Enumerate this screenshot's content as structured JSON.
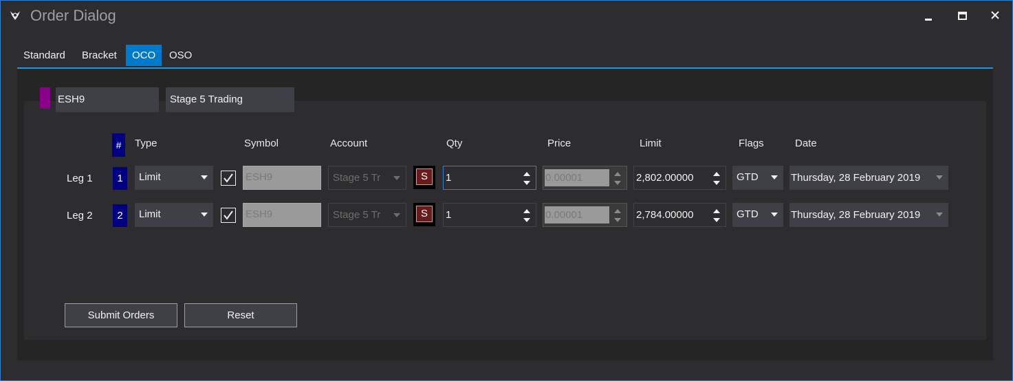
{
  "window": {
    "title": "Order Dialog"
  },
  "tabs": [
    {
      "label": "Standard"
    },
    {
      "label": "Bracket"
    },
    {
      "label": "OCO",
      "active": true
    },
    {
      "label": "OSO"
    }
  ],
  "header": {
    "instrument": "ESH9",
    "account": "Stage 5 Trading",
    "swatch_color": "#8b008b"
  },
  "columns": {
    "hash": "#",
    "type": "Type",
    "symbol": "Symbol",
    "account": "Account",
    "qty": "Qty",
    "price": "Price",
    "limit": "Limit",
    "flags": "Flags",
    "date": "Date"
  },
  "legs": [
    {
      "label": "Leg 1",
      "num": "1",
      "type": "Limit",
      "checked": true,
      "symbol": "ESH9",
      "account": "Stage 5 Tr",
      "s_button": "S",
      "qty": "1",
      "price": "0.00001",
      "limit": "2,802.00000",
      "flags": "GTD",
      "date": "Thursday, 28 February 2019"
    },
    {
      "label": "Leg 2",
      "num": "2",
      "type": "Limit",
      "checked": true,
      "symbol": "ESH9",
      "account": "Stage 5 Tr",
      "s_button": "S",
      "qty": "1",
      "price": "0.00001",
      "limit": "2,784.00000",
      "flags": "GTD",
      "date": "Thursday, 28 February 2019"
    }
  ],
  "buttons": {
    "submit": "Submit Orders",
    "reset": "Reset"
  },
  "colors": {
    "accent": "#007acc",
    "leg_badge": "#000080",
    "s_button": "#6b1a1a"
  }
}
